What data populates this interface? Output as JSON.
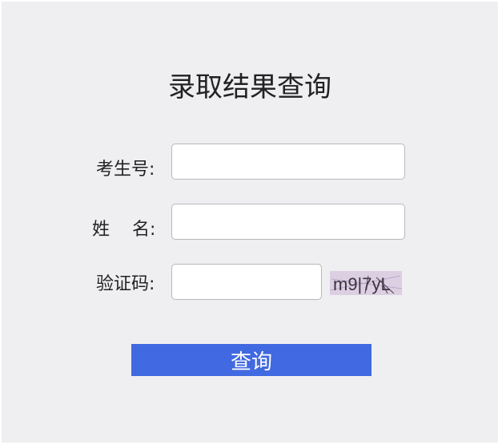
{
  "form": {
    "title": "录取结果查询",
    "fields": [
      {
        "label": "考生号:",
        "value": "",
        "placeholder": ""
      },
      {
        "label": "姓    名:",
        "value": "",
        "placeholder": ""
      },
      {
        "label": "验证码:",
        "value": "",
        "placeholder": ""
      }
    ],
    "captcha_text": "m9|7yL",
    "submit_label": "查询"
  },
  "colors": {
    "background": "#efeff2",
    "button": "#4169e1",
    "captcha_background": "#dccfe2"
  }
}
